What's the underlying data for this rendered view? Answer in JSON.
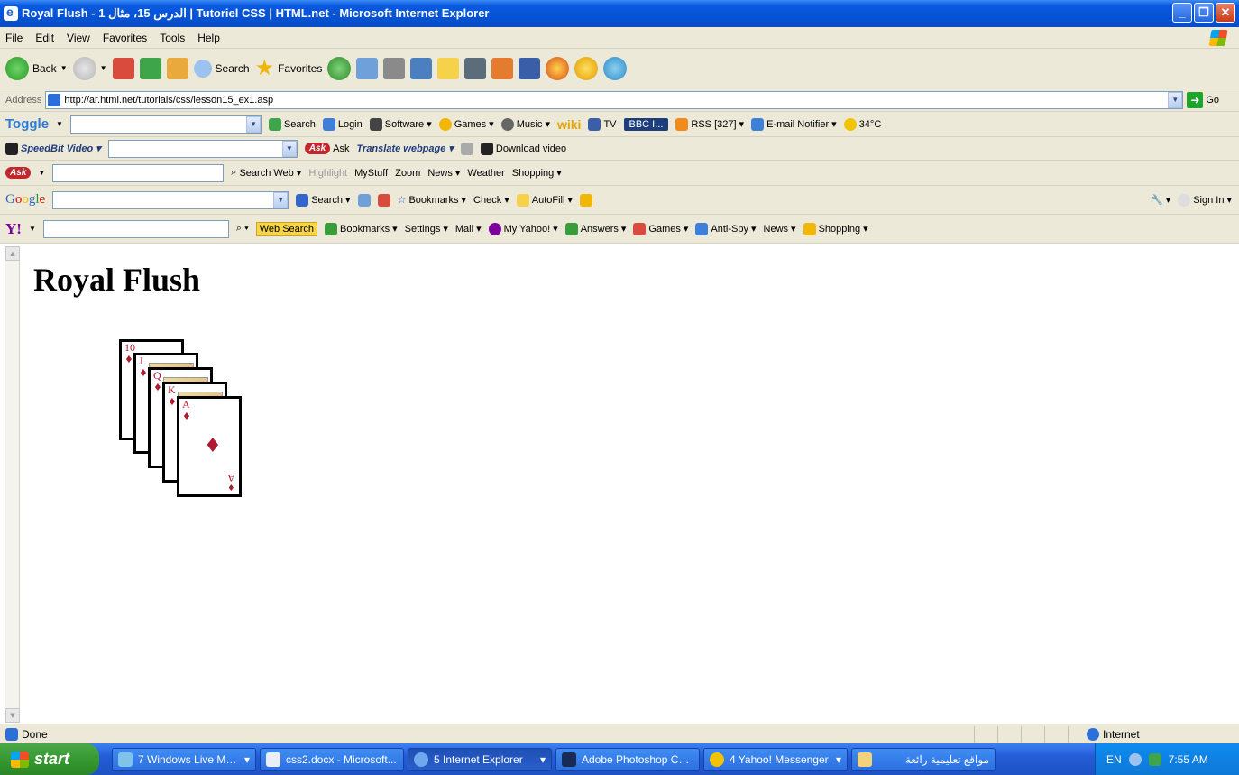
{
  "window": {
    "title": "Royal Flush - الدرس 15، مثال 1 | Tutoriel CSS | HTML.net - Microsoft Internet Explorer"
  },
  "menu": [
    "File",
    "Edit",
    "View",
    "Favorites",
    "Tools",
    "Help"
  ],
  "std_toolbar": {
    "back": "Back",
    "search": "Search",
    "favorites": "Favorites"
  },
  "address": {
    "label": "Address",
    "url": "http://ar.html.net/tutorials/css/lesson15_ex1.asp",
    "go": "Go"
  },
  "toggle_bar": {
    "brand": "Toggle",
    "search": "Search",
    "login": "Login",
    "software": "Software",
    "games": "Games",
    "music": "Music",
    "wiki": "wiki",
    "tv": "TV",
    "radio": "BBC I...",
    "rss": "RSS [327]",
    "email": "E-mail Notifier",
    "weather": "34°C"
  },
  "speedbit_bar": {
    "brand": "SpeedBit Video",
    "ask": "Ask",
    "translate": "Translate webpage",
    "download": "Download video"
  },
  "ask_bar": {
    "brand": "Ask",
    "search_web": "Search Web",
    "highlight": "Highlight",
    "mystuff": "MyStuff",
    "zoom": "Zoom",
    "news": "News",
    "weather": "Weather",
    "shopping": "Shopping"
  },
  "google_bar": {
    "brand": "Google",
    "search": "Search",
    "bookmarks": "Bookmarks",
    "check": "Check",
    "autofill": "AutoFill",
    "signin": "Sign In"
  },
  "yahoo_bar": {
    "brand": "Y!",
    "websearch": "Web Search",
    "bookmarks": "Bookmarks",
    "settings": "Settings",
    "mail": "Mail",
    "myyahoo": "My Yahoo!",
    "answers": "Answers",
    "games": "Games",
    "antispy": "Anti-Spy",
    "news": "News",
    "shopping": "Shopping"
  },
  "page": {
    "heading": "Royal Flush",
    "cards": [
      {
        "rank": "10",
        "suit": "♦"
      },
      {
        "rank": "J",
        "suit": "♦"
      },
      {
        "rank": "Q",
        "suit": "♦"
      },
      {
        "rank": "K",
        "suit": "♦"
      },
      {
        "rank": "A",
        "suit": "♦"
      }
    ]
  },
  "status": {
    "text": "Done",
    "zone": "Internet"
  },
  "taskbar": {
    "start": "start",
    "tasks": [
      "7 Windows Live Mes...",
      "css2.docx - Microsoft...",
      "5 Internet Explorer",
      "Adobe Photoshop CS...",
      "4 Yahoo! Messenger",
      "مواقع تعليمية رائعة"
    ],
    "lang": "EN",
    "time": "7:55 AM"
  }
}
